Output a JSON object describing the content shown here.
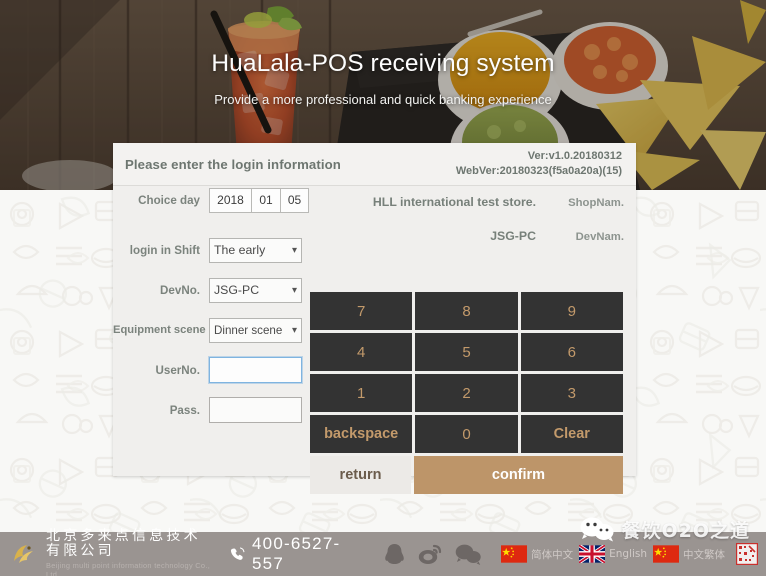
{
  "hero": {
    "title": "HuaLala-POS receiving system",
    "subtitle": "Provide a more professional and quick banking experience"
  },
  "panel": {
    "title": "Please enter the login information",
    "version_line1": "Ver:v1.0.20180312",
    "version_line2": "WebVer:20180323(f5a0a20a)(15)",
    "store": {
      "shop_name_value": "HLL international test store.",
      "shop_name_key": "ShopNam.",
      "dev_name_value": "JSG-PC",
      "dev_name_key": "DevNam."
    },
    "form": {
      "choice_day_label": "Choice day",
      "choice_day_year": "2018",
      "choice_day_month": "01",
      "choice_day_day": "05",
      "shift_label": "login in Shift",
      "shift_value": "The early",
      "devno_label": "DevNo.",
      "devno_value": "JSG-PC",
      "scene_label": "Equipment scene",
      "scene_value": "Dinner scene",
      "userno_label": "UserNo.",
      "userno_value": "",
      "userno_placeholder": "",
      "pass_label": "Pass.",
      "pass_value": "",
      "pass_placeholder": ""
    },
    "keypad": {
      "rows": [
        [
          "7",
          "8",
          "9"
        ],
        [
          "4",
          "5",
          "6"
        ],
        [
          "1",
          "2",
          "3"
        ]
      ],
      "row4": [
        "backspace",
        "0",
        "Clear"
      ],
      "return_label": "return",
      "confirm_label": "confirm"
    },
    "colors": {
      "key_bg": "#333333",
      "key_text": "#c39a6b",
      "confirm_bg": "#bd9569",
      "panel_bg": "#f0efed"
    }
  },
  "footer": {
    "company_cn": "北京多来点信息技术有限公司",
    "company_en": "Beijing multi point information technology Co., Ltd.",
    "phone": "400-6527-557",
    "social": [
      "qq-icon",
      "weibo-icon",
      "wechat-icon"
    ],
    "languages": [
      {
        "label": "简体中文",
        "flag": "flag-cn"
      },
      {
        "label": "English",
        "flag": "flag-uk"
      },
      {
        "label": "中文繁体",
        "flag": "flag-cn"
      }
    ],
    "qr_icon": "qrcode-icon"
  },
  "overlay": {
    "wechat_account": "餐饮O2O之道",
    "wechat_icon": "wechat-icon"
  }
}
